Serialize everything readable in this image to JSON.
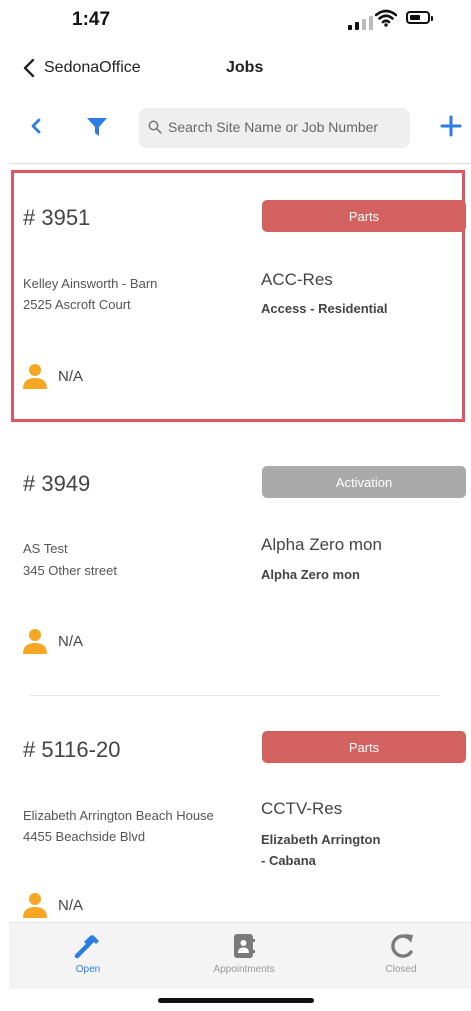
{
  "status_bar": {
    "time": "1:47"
  },
  "nav": {
    "back_label": "SedonaOffice",
    "title": "Jobs"
  },
  "toolbar": {
    "search_placeholder": "Search Site Name or Job Number"
  },
  "jobs": [
    {
      "number": "# 3951",
      "status": "Parts",
      "status_color": "#d36160",
      "client_name": "Kelley Ainsworth - Barn",
      "address": "2525 Ascroft Court",
      "code": "ACC-Res",
      "description": [
        "Access - Residential"
      ],
      "assignee": "N/A"
    },
    {
      "number": "# 3949",
      "status": "Activation",
      "status_color": "#aaaaaa",
      "client_name": "AS Test",
      "address": "345 Other street",
      "code": "Alpha Zero mon",
      "description": [
        "Alpha Zero mon"
      ],
      "assignee": "N/A"
    },
    {
      "number": "# 5116-20",
      "status": "Parts",
      "status_color": "#d36160",
      "client_name": "Elizabeth Arrington Beach House",
      "address": "4455 Beachside Blvd",
      "code": "CCTV-Res",
      "description": [
        "Elizabeth Arrington",
        "- Cabana"
      ],
      "assignee": "N/A"
    }
  ],
  "tabs": [
    {
      "label": "Open",
      "icon": "hammer-icon",
      "active": true
    },
    {
      "label": "Appointments",
      "icon": "contacts-book-icon",
      "active": false
    },
    {
      "label": "Closed",
      "icon": "refresh-icon",
      "active": false
    }
  ],
  "colors": {
    "accent": "#2b7de1",
    "parts": "#d36160",
    "activation": "#aaaaaa",
    "person": "#f5a623",
    "highlight": "#e05660"
  }
}
